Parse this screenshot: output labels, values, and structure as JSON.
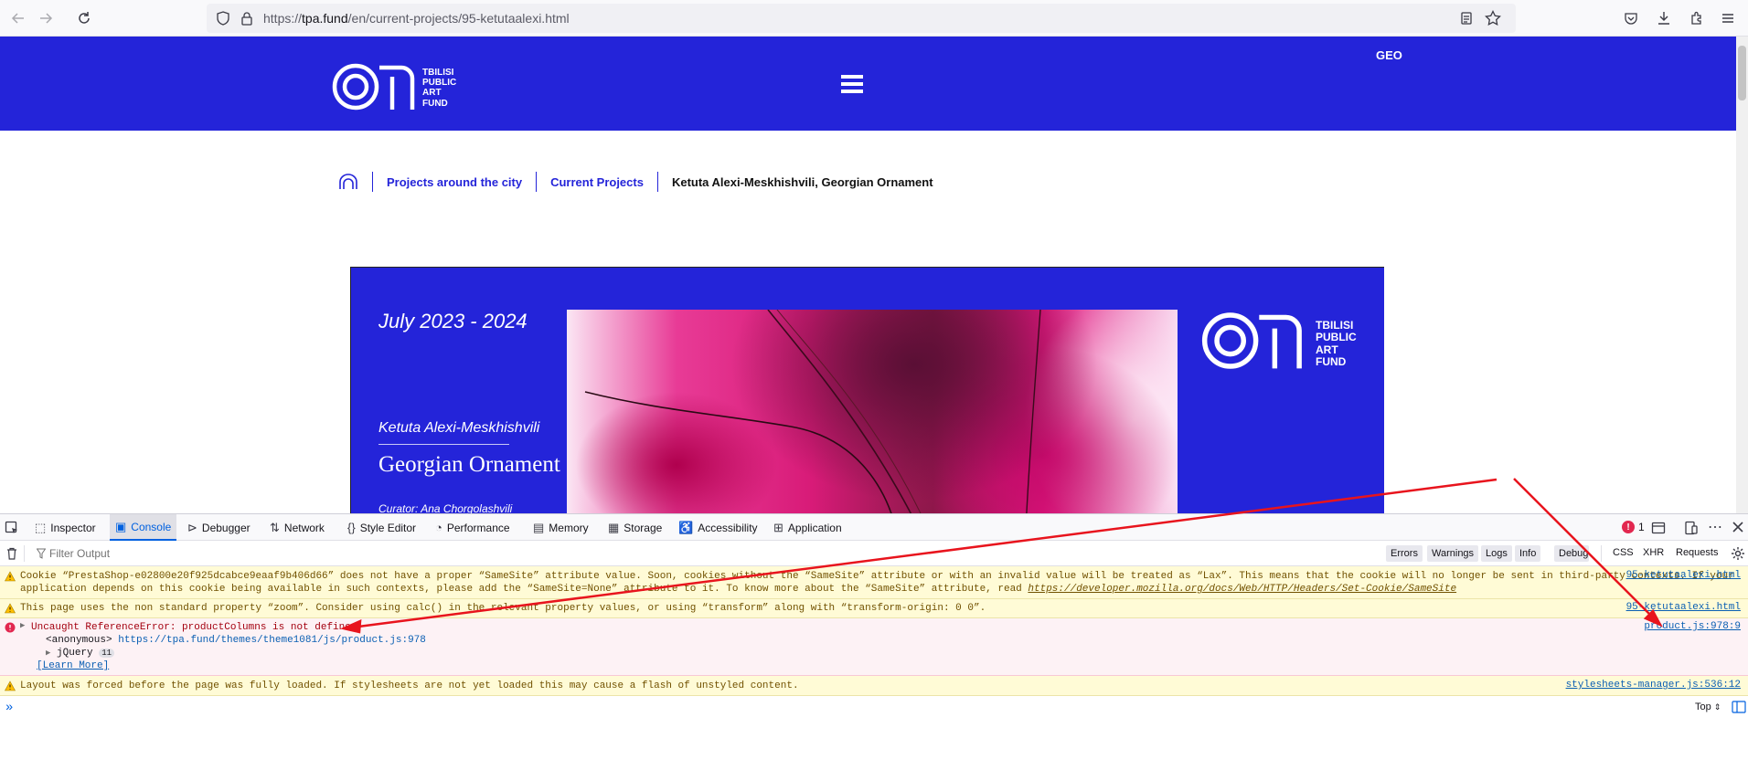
{
  "browser": {
    "url_prefix": "https://",
    "url_host": "tpa.fund",
    "url_path": "/en/current-projects/95-ketutaalexi.html"
  },
  "site": {
    "logo_lines": [
      "TBILISI",
      "PUBLIC",
      "ART",
      "FUND"
    ],
    "lang_switch": "GEO",
    "breadcrumb": {
      "level1": "Projects around the city",
      "level2": "Current Projects",
      "current": "Ketuta Alexi-Meskhishvili, Georgian Ornament"
    },
    "banner": {
      "date": "July  2023 - 2024",
      "artist": "Ketuta Alexi-Meskhishvili",
      "title": "Georgian Ornament",
      "curator": "Curator: Ana Chorgolashvili"
    }
  },
  "devtools": {
    "tabs": [
      "Inspector",
      "Console",
      "Debugger",
      "Network",
      "Style Editor",
      "Performance",
      "Memory",
      "Storage",
      "Accessibility",
      "Application"
    ],
    "active_tab": "Console",
    "error_count": "1",
    "filter_placeholder": "Filter Output",
    "filter_levels": [
      "Errors",
      "Warnings",
      "Logs",
      "Info",
      "Debug"
    ],
    "filter_types": [
      "CSS",
      "XHR",
      "Requests"
    ],
    "messages": [
      {
        "level": "warning",
        "line1": "Cookie “PrestaShop-e02800e20f925dcabce9eaaf9b406d66” does not have a proper “SameSite” attribute value. Soon, cookies without the “SameSite” attribute or with an invalid value will be treated as “Lax”. This means that the cookie will no longer be sent in third-party contexts. If your",
        "line2_text": "application depends on this cookie being available in such contexts, please add the “SameSite=None” attribute to it. To know more about the “SameSite” attribute, read ",
        "line2_link": "https://developer.mozilla.org/docs/Web/HTTP/Headers/Set-Cookie/SameSite",
        "source": "95-ketutaalexi.html"
      },
      {
        "level": "warning",
        "line1": "This page uses the non standard property “zoom”. Consider using calc() in the relevant property values, or using “transform” along with “transform-origin: 0 0”.",
        "source": "95-ketutaalexi.html"
      },
      {
        "level": "error",
        "line1": "Uncaught ReferenceError: productColumns is not defined",
        "trace_fn": "<anonymous>",
        "trace_url": "https://tpa.fund/themes/theme1081/js/product.js:978",
        "trace_jquery": "jQuery",
        "trace_jquery_count": "11",
        "learn_more": "[Learn More]",
        "source": "product.js:978:9"
      },
      {
        "level": "warning",
        "line1": "Layout was forced before the page was fully loaded. If stylesheets are not yet loaded this may cause a flash of unstyled content.",
        "source": "stylesheets-manager.js:536:12"
      }
    ],
    "context_selector": "Top"
  },
  "colors": {
    "brand_blue": "#2424d9",
    "annotation_red": "#e8141d"
  }
}
